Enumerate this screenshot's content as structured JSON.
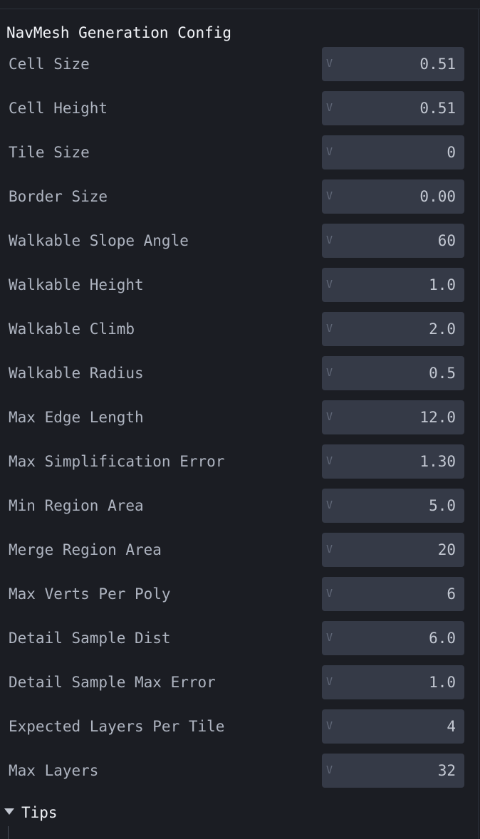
{
  "panel": {
    "title": "NavMesh Generation Config"
  },
  "fields": [
    {
      "label": "Cell Size",
      "value": "0.51",
      "prefix": "V"
    },
    {
      "label": "Cell Height",
      "value": "0.51",
      "prefix": "V"
    },
    {
      "label": "Tile Size",
      "value": "0",
      "prefix": "V"
    },
    {
      "label": "Border Size",
      "value": "0.00",
      "prefix": "V"
    },
    {
      "label": "Walkable Slope Angle",
      "value": "60",
      "prefix": "V"
    },
    {
      "label": "Walkable Height",
      "value": "1.0",
      "prefix": "V"
    },
    {
      "label": "Walkable Climb",
      "value": "2.0",
      "prefix": "V"
    },
    {
      "label": "Walkable Radius",
      "value": "0.5",
      "prefix": "V"
    },
    {
      "label": "Max Edge Length",
      "value": "12.0",
      "prefix": "V"
    },
    {
      "label": "Max Simplification Error",
      "value": "1.30",
      "prefix": "V"
    },
    {
      "label": "Min Region Area",
      "value": "5.0",
      "prefix": "V"
    },
    {
      "label": "Merge Region Area",
      "value": "20",
      "prefix": "V"
    },
    {
      "label": "Max Verts Per Poly",
      "value": "6",
      "prefix": "V"
    },
    {
      "label": "Detail Sample Dist",
      "value": "6.0",
      "prefix": "V"
    },
    {
      "label": "Detail Sample Max Error",
      "value": "1.0",
      "prefix": "V"
    },
    {
      "label": "Expected Layers Per Tile",
      "value": "4",
      "prefix": "V"
    },
    {
      "label": "Max Layers",
      "value": "32",
      "prefix": "V"
    }
  ],
  "tips": {
    "label": "Tips",
    "icon": "caret-down-icon",
    "expanded": true
  },
  "colors": {
    "background": "#1b1d23",
    "input_background": "#353a47",
    "label_text": "#aeb4c0",
    "title_text": "#f2f4f8"
  }
}
